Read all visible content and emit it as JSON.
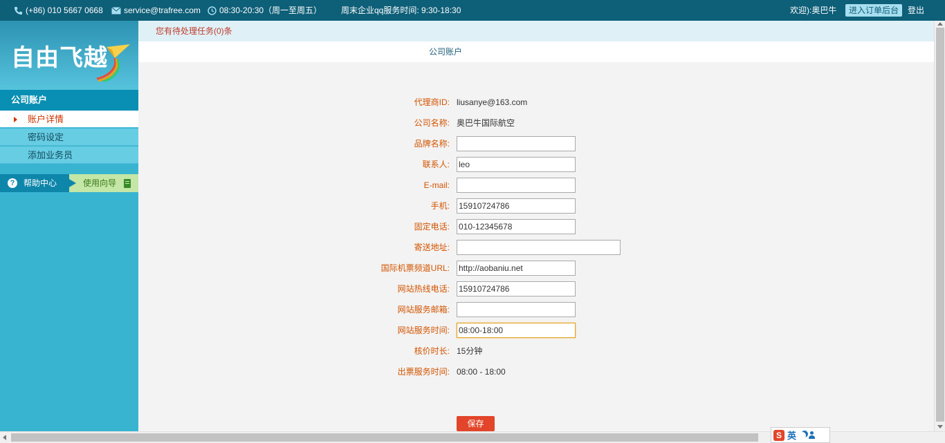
{
  "topbar": {
    "phone": "(+86) 010 5667 0668",
    "email": "service@trafree.com",
    "hours": "08:30-20:30（周一至周五）",
    "weekend": "周末企业qq服务时间: 9:30-18:30",
    "welcome": "欢迎):奥巴牛",
    "enter_button": "进入订单后台",
    "logout": "登出"
  },
  "sidebar": {
    "logo_text": "自由飞越",
    "section_title": "公司账户",
    "items": [
      {
        "label": "账户详情",
        "active": true
      },
      {
        "label": "密码设定",
        "active": false
      },
      {
        "label": "添加业务员",
        "active": false
      }
    ],
    "help_center": "帮助中心",
    "guide": "使用向导"
  },
  "notice": "您有待处理任务(0)条",
  "page_title": "公司账户",
  "form": {
    "agent_id": {
      "label": "代理商ID:",
      "value": "liusanye@163.com"
    },
    "company_name": {
      "label": "公司名称:",
      "value": "奥巴牛国际航空"
    },
    "brand_name": {
      "label": "品牌名称:",
      "value": ""
    },
    "contact": {
      "label": "联系人:",
      "value": "leo"
    },
    "email": {
      "label": "E-mail:",
      "value": ""
    },
    "mobile": {
      "label": "手机:",
      "value": "15910724786"
    },
    "landline": {
      "label": "固定电话:",
      "value": "010-12345678"
    },
    "address": {
      "label": "寄送地址:",
      "value": ""
    },
    "intl_url": {
      "label": "国际机票频道URL:",
      "value": "http://aobaniu.net"
    },
    "hotline": {
      "label": "网站热线电话:",
      "value": "15910724786"
    },
    "service_email": {
      "label": "网站服务邮箱:",
      "value": ""
    },
    "service_hours": {
      "label": "网站服务时间:",
      "value": "08:00-18:00"
    },
    "pricing_time": {
      "label": "核价时长:",
      "value": "15分钟"
    },
    "ticketing_time": {
      "label": "出票服务时间:",
      "value": "08:00 - 18:00"
    },
    "save_label": "保存"
  },
  "ime": {
    "mode": "英",
    "logo": "S"
  }
}
